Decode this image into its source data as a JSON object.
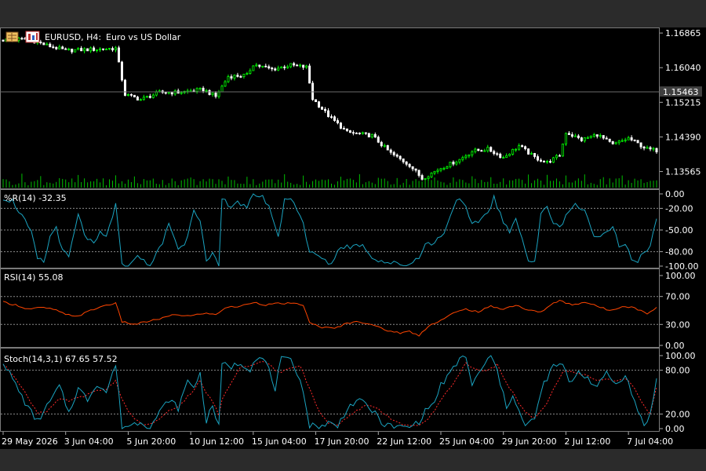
{
  "header": {
    "symbol_info": "EURUSD, H4:",
    "description": "Euro vs US Dollar"
  },
  "price_pane": {
    "ticks": [
      "1.16865",
      "1.16040",
      "1.15215",
      "1.14390",
      "1.13565"
    ],
    "tick_values": [
      1.16865,
      1.1604,
      1.15215,
      1.1439,
      1.13565
    ],
    "ylim": [
      1.1322,
      1.1696
    ],
    "current_price": "1.15463",
    "current_price_value": 1.15463,
    "bull_color": "#00ff00",
    "bear_color": "#ffffff",
    "volume_color": "#00c000"
  },
  "wpr_pane": {
    "title": "%R(14) -32.35",
    "ticks": [
      "0.00",
      "-20.00",
      "-50.00",
      "-80.00",
      "-100.00"
    ],
    "tick_values": [
      0,
      -20,
      -50,
      -80,
      -100
    ],
    "levels": [
      -20,
      -50,
      -80
    ],
    "line_color": "#1aa3c0"
  },
  "rsi_pane": {
    "title": "RSI(14) 55.08",
    "ticks": [
      "100.00",
      "70.00",
      "30.00",
      "0.00"
    ],
    "tick_values": [
      100,
      70,
      30,
      0
    ],
    "levels": [
      70,
      30
    ],
    "line_color": "#ff4500"
  },
  "stoch_pane": {
    "title": "Stoch(14,3,1) 67.65 57.52",
    "ticks": [
      "100.00",
      "80.00",
      "20.00",
      "0.00"
    ],
    "tick_values": [
      100,
      80,
      20,
      0
    ],
    "levels": [
      80,
      20
    ],
    "main_color": "#1aa3c0",
    "signal_color": "#ff2a2a"
  },
  "time_axis": {
    "labels": [
      "29 May 2026",
      "3 Jun 04:00",
      "5 Jun 20:00",
      "10 Jun 12:00",
      "15 Jun 04:00",
      "17 Jun 20:00",
      "22 Jun 12:00",
      "25 Jun 04:00",
      "29 Jun 20:00",
      "2 Jul 12:00",
      "7 Jul 04:00"
    ],
    "label_bars": [
      0,
      20,
      40,
      60,
      80,
      100,
      120,
      140,
      160,
      180,
      200
    ]
  },
  "chart_data": {
    "type": "line",
    "bars": 210,
    "close_path": [
      [
        0,
        1.167
      ],
      [
        8,
        1.1672
      ],
      [
        14,
        1.1657
      ],
      [
        20,
        1.1645
      ],
      [
        30,
        1.1648
      ],
      [
        36,
        1.165
      ],
      [
        39,
        1.154
      ],
      [
        44,
        1.1528
      ],
      [
        50,
        1.1545
      ],
      [
        56,
        1.1545
      ],
      [
        64,
        1.1552
      ],
      [
        68,
        1.1535
      ],
      [
        72,
        1.1583
      ],
      [
        78,
        1.1586
      ],
      [
        80,
        1.1612
      ],
      [
        86,
        1.16
      ],
      [
        92,
        1.161
      ],
      [
        97,
        1.1605
      ],
      [
        99,
        1.153
      ],
      [
        104,
        1.149
      ],
      [
        110,
        1.145
      ],
      [
        118,
        1.1442
      ],
      [
        124,
        1.14
      ],
      [
        130,
        1.1372
      ],
      [
        134,
        1.134
      ],
      [
        140,
        1.1365
      ],
      [
        146,
        1.1385
      ],
      [
        150,
        1.1405
      ],
      [
        155,
        1.141
      ],
      [
        160,
        1.139
      ],
      [
        165,
        1.1418
      ],
      [
        170,
        1.139
      ],
      [
        174,
        1.1378
      ],
      [
        178,
        1.1395
      ],
      [
        180,
        1.145
      ],
      [
        185,
        1.1432
      ],
      [
        190,
        1.1445
      ],
      [
        195,
        1.142
      ],
      [
        200,
        1.1436
      ],
      [
        206,
        1.141
      ],
      [
        209,
        1.1407
      ]
    ],
    "wpr_path": [
      [
        0,
        -5
      ],
      [
        3,
        -10
      ],
      [
        6,
        -30
      ],
      [
        9,
        -55
      ],
      [
        11,
        -90
      ],
      [
        13,
        -95
      ],
      [
        15,
        -60
      ],
      [
        17,
        -45
      ],
      [
        19,
        -80
      ],
      [
        21,
        -88
      ],
      [
        24,
        -30
      ],
      [
        26,
        -55
      ],
      [
        29,
        -72
      ],
      [
        31,
        -55
      ],
      [
        33,
        -60
      ],
      [
        36,
        -15
      ],
      [
        38,
        -100
      ],
      [
        41,
        -98
      ],
      [
        43,
        -82
      ],
      [
        46,
        -100
      ],
      [
        48,
        -92
      ],
      [
        51,
        -68
      ],
      [
        53,
        -40
      ],
      [
        56,
        -75
      ],
      [
        58,
        -72
      ],
      [
        61,
        -20
      ],
      [
        63,
        -35
      ],
      [
        65,
        -96
      ],
      [
        67,
        -85
      ],
      [
        69,
        -100
      ],
      [
        70,
        -8
      ],
      [
        73,
        -16
      ],
      [
        75,
        -10
      ],
      [
        78,
        -22
      ],
      [
        80,
        0
      ],
      [
        83,
        -3
      ],
      [
        86,
        -28
      ],
      [
        88,
        -62
      ],
      [
        90,
        -6
      ],
      [
        93,
        -10
      ],
      [
        96,
        -40
      ],
      [
        98,
        -82
      ],
      [
        101,
        -86
      ],
      [
        103,
        -94
      ],
      [
        105,
        -96
      ],
      [
        108,
        -72
      ],
      [
        111,
        -73
      ],
      [
        114,
        -70
      ],
      [
        116,
        -75
      ],
      [
        118,
        -88
      ],
      [
        122,
        -94
      ],
      [
        126,
        -97
      ],
      [
        130,
        -98
      ],
      [
        133,
        -86
      ],
      [
        135,
        -70
      ],
      [
        138,
        -68
      ],
      [
        141,
        -52
      ],
      [
        143,
        -32
      ],
      [
        145,
        -5
      ],
      [
        148,
        -20
      ],
      [
        150,
        -45
      ],
      [
        152,
        -38
      ],
      [
        155,
        -25
      ],
      [
        157,
        -5
      ],
      [
        160,
        -40
      ],
      [
        162,
        -55
      ],
      [
        164,
        -30
      ],
      [
        166,
        -62
      ],
      [
        168,
        -92
      ],
      [
        170,
        -96
      ],
      [
        172,
        -30
      ],
      [
        174,
        -16
      ],
      [
        176,
        -40
      ],
      [
        178,
        -48
      ],
      [
        180,
        -28
      ],
      [
        183,
        -14
      ],
      [
        186,
        -25
      ],
      [
        188,
        -48
      ],
      [
        190,
        -62
      ],
      [
        192,
        -55
      ],
      [
        195,
        -42
      ],
      [
        197,
        -72
      ],
      [
        199,
        -68
      ],
      [
        201,
        -92
      ],
      [
        203,
        -96
      ],
      [
        205,
        -80
      ],
      [
        207,
        -72
      ],
      [
        209,
        -32
      ]
    ],
    "rsi_path": [
      [
        0,
        62
      ],
      [
        4,
        58
      ],
      [
        8,
        52
      ],
      [
        12,
        54
      ],
      [
        16,
        52
      ],
      [
        20,
        44
      ],
      [
        24,
        42
      ],
      [
        28,
        50
      ],
      [
        33,
        58
      ],
      [
        36,
        60
      ],
      [
        38,
        34
      ],
      [
        42,
        30
      ],
      [
        46,
        34
      ],
      [
        50,
        38
      ],
      [
        55,
        44
      ],
      [
        60,
        42
      ],
      [
        64,
        46
      ],
      [
        68,
        44
      ],
      [
        71,
        54
      ],
      [
        76,
        56
      ],
      [
        80,
        62
      ],
      [
        84,
        58
      ],
      [
        88,
        60
      ],
      [
        92,
        60
      ],
      [
        96,
        58
      ],
      [
        98,
        32
      ],
      [
        102,
        26
      ],
      [
        106,
        24
      ],
      [
        110,
        32
      ],
      [
        114,
        34
      ],
      [
        118,
        30
      ],
      [
        122,
        22
      ],
      [
        127,
        18
      ],
      [
        130,
        20
      ],
      [
        133,
        14
      ],
      [
        136,
        28
      ],
      [
        140,
        36
      ],
      [
        144,
        46
      ],
      [
        148,
        52
      ],
      [
        152,
        48
      ],
      [
        156,
        56
      ],
      [
        160,
        52
      ],
      [
        164,
        58
      ],
      [
        168,
        50
      ],
      [
        172,
        48
      ],
      [
        176,
        60
      ],
      [
        178,
        64
      ],
      [
        182,
        58
      ],
      [
        186,
        62
      ],
      [
        190,
        56
      ],
      [
        194,
        50
      ],
      [
        198,
        56
      ],
      [
        202,
        54
      ],
      [
        206,
        45
      ],
      [
        209,
        55
      ]
    ],
    "stoch_main_path": [
      [
        0,
        92
      ],
      [
        4,
        60
      ],
      [
        8,
        28
      ],
      [
        11,
        10
      ],
      [
        14,
        30
      ],
      [
        18,
        58
      ],
      [
        21,
        22
      ],
      [
        24,
        55
      ],
      [
        27,
        40
      ],
      [
        30,
        62
      ],
      [
        33,
        50
      ],
      [
        36,
        88
      ],
      [
        38,
        2
      ],
      [
        41,
        5
      ],
      [
        44,
        10
      ],
      [
        47,
        2
      ],
      [
        50,
        22
      ],
      [
        53,
        40
      ],
      [
        56,
        28
      ],
      [
        59,
        65
      ],
      [
        61,
        58
      ],
      [
        63,
        75
      ],
      [
        65,
        10
      ],
      [
        67,
        32
      ],
      [
        69,
        2
      ],
      [
        70,
        88
      ],
      [
        73,
        85
      ],
      [
        76,
        90
      ],
      [
        79,
        82
      ],
      [
        81,
        98
      ],
      [
        84,
        92
      ],
      [
        87,
        55
      ],
      [
        89,
        95
      ],
      [
        92,
        92
      ],
      [
        95,
        70
      ],
      [
        98,
        5
      ],
      [
        101,
        2
      ],
      [
        104,
        8
      ],
      [
        107,
        3
      ],
      [
        110,
        28
      ],
      [
        113,
        38
      ],
      [
        116,
        34
      ],
      [
        119,
        20
      ],
      [
        122,
        5
      ],
      [
        126,
        2
      ],
      [
        130,
        2
      ],
      [
        133,
        10
      ],
      [
        136,
        30
      ],
      [
        138,
        35
      ],
      [
        140,
        60
      ],
      [
        143,
        75
      ],
      [
        146,
        95
      ],
      [
        148,
        100
      ],
      [
        150,
        58
      ],
      [
        153,
        82
      ],
      [
        156,
        100
      ],
      [
        158,
        80
      ],
      [
        161,
        28
      ],
      [
        163,
        48
      ],
      [
        165,
        24
      ],
      [
        167,
        2
      ],
      [
        170,
        15
      ],
      [
        173,
        62
      ],
      [
        176,
        85
      ],
      [
        179,
        88
      ],
      [
        181,
        62
      ],
      [
        184,
        78
      ],
      [
        187,
        70
      ],
      [
        190,
        55
      ],
      [
        193,
        78
      ],
      [
        196,
        60
      ],
      [
        199,
        75
      ],
      [
        202,
        35
      ],
      [
        205,
        5
      ],
      [
        207,
        20
      ],
      [
        209,
        67
      ]
    ],
    "stoch_signal_path": [
      [
        0,
        88
      ],
      [
        4,
        70
      ],
      [
        8,
        42
      ],
      [
        11,
        22
      ],
      [
        14,
        24
      ],
      [
        18,
        40
      ],
      [
        21,
        38
      ],
      [
        24,
        42
      ],
      [
        27,
        46
      ],
      [
        30,
        52
      ],
      [
        33,
        54
      ],
      [
        36,
        66
      ],
      [
        38,
        40
      ],
      [
        41,
        18
      ],
      [
        44,
        6
      ],
      [
        47,
        6
      ],
      [
        50,
        12
      ],
      [
        53,
        24
      ],
      [
        56,
        30
      ],
      [
        59,
        44
      ],
      [
        61,
        52
      ],
      [
        63,
        66
      ],
      [
        65,
        48
      ],
      [
        67,
        38
      ],
      [
        69,
        18
      ],
      [
        70,
        40
      ],
      [
        73,
        64
      ],
      [
        76,
        86
      ],
      [
        79,
        86
      ],
      [
        81,
        90
      ],
      [
        84,
        92
      ],
      [
        87,
        80
      ],
      [
        89,
        78
      ],
      [
        92,
        82
      ],
      [
        95,
        86
      ],
      [
        98,
        55
      ],
      [
        101,
        24
      ],
      [
        104,
        8
      ],
      [
        107,
        5
      ],
      [
        110,
        14
      ],
      [
        113,
        24
      ],
      [
        116,
        32
      ],
      [
        119,
        30
      ],
      [
        122,
        20
      ],
      [
        126,
        8
      ],
      [
        130,
        3
      ],
      [
        133,
        5
      ],
      [
        136,
        14
      ],
      [
        138,
        24
      ],
      [
        140,
        40
      ],
      [
        143,
        56
      ],
      [
        146,
        76
      ],
      [
        148,
        90
      ],
      [
        150,
        82
      ],
      [
        153,
        80
      ],
      [
        156,
        82
      ],
      [
        158,
        88
      ],
      [
        161,
        62
      ],
      [
        163,
        50
      ],
      [
        165,
        34
      ],
      [
        167,
        22
      ],
      [
        170,
        14
      ],
      [
        173,
        28
      ],
      [
        176,
        54
      ],
      [
        179,
        78
      ],
      [
        181,
        78
      ],
      [
        184,
        76
      ],
      [
        187,
        72
      ],
      [
        190,
        66
      ],
      [
        193,
        68
      ],
      [
        196,
        64
      ],
      [
        199,
        70
      ],
      [
        202,
        54
      ],
      [
        205,
        32
      ],
      [
        207,
        20
      ],
      [
        209,
        58
      ]
    ]
  }
}
